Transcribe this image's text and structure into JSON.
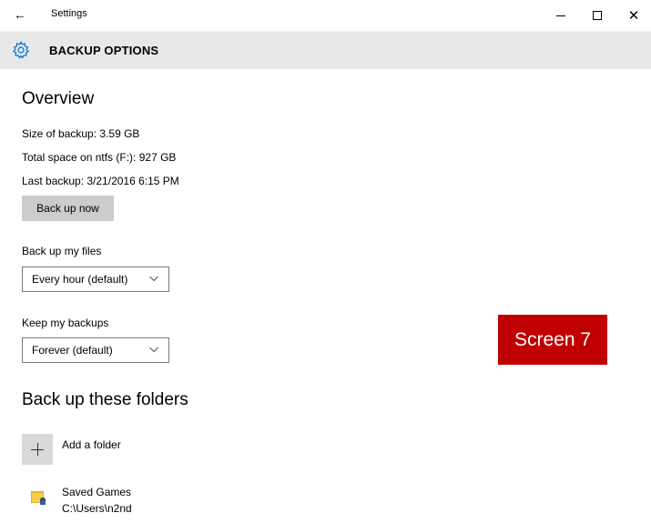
{
  "window": {
    "title": "Settings",
    "back_icon": "back-arrow-icon",
    "minimize_icon": "minimize-icon",
    "maximize_icon": "maximize-icon",
    "close_icon": "close-icon",
    "close_glyph": "✕",
    "back_glyph": "←"
  },
  "header": {
    "icon": "gear-icon",
    "title": "BACKUP OPTIONS",
    "accent_color": "#0078d7"
  },
  "overview": {
    "heading": "Overview",
    "size_of_backup": "Size of backup: 3.59 GB",
    "total_space": "Total space on ntfs (F:): 927 GB",
    "last_backup": "Last backup: 3/21/2016 6:15 PM",
    "back_up_now_label": "Back up now"
  },
  "backup_frequency": {
    "label": "Back up my files",
    "selected": "Every hour (default)"
  },
  "keep_backups": {
    "label": "Keep my backups",
    "selected": "Forever (default)"
  },
  "badge": {
    "text": "Screen 7",
    "color": "#c00000"
  },
  "folders": {
    "heading": "Back up these folders",
    "add_label": "Add a folder",
    "add_icon": "plus-icon",
    "items": [
      {
        "name": "Saved Games",
        "path": "C:\\Users\\n2nd",
        "icon": "folder-icon"
      }
    ]
  }
}
